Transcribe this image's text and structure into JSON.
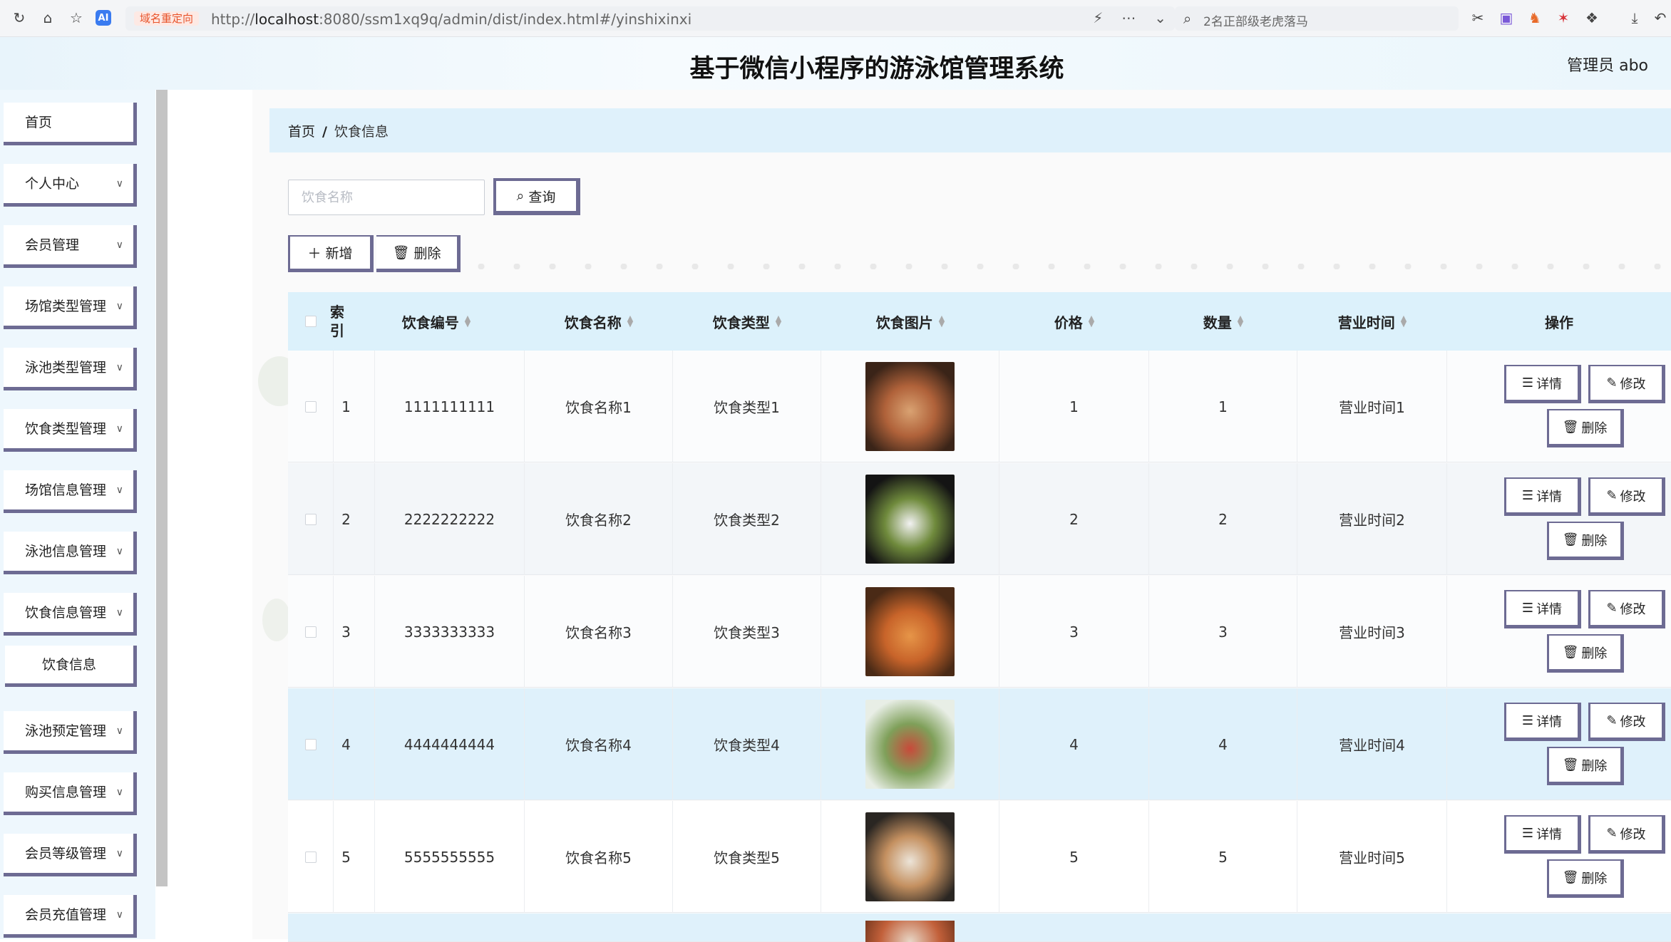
{
  "browser": {
    "redirect_badge": "域名重定向",
    "url_prefix": "http://",
    "url_host": "localhost",
    "url_rest": ":8080/ssm1xq9q/admin/dist/index.html#/yinshixinxi",
    "search_text": "2名正部级老虎落马"
  },
  "header": {
    "title": "基于微信小程序的游泳馆管理系统",
    "user": "管理员 abo"
  },
  "sidebar": {
    "items": [
      {
        "label": "首页",
        "has_arrow": false
      },
      {
        "label": "个人中心",
        "has_arrow": true
      },
      {
        "label": "会员管理",
        "has_arrow": true
      },
      {
        "label": "场馆类型管理",
        "has_arrow": true
      },
      {
        "label": "泳池类型管理",
        "has_arrow": true
      },
      {
        "label": "饮食类型管理",
        "has_arrow": true
      },
      {
        "label": "场馆信息管理",
        "has_arrow": true
      },
      {
        "label": "泳池信息管理",
        "has_arrow": true
      },
      {
        "label": "饮食信息管理",
        "has_arrow": true
      },
      {
        "label": "饮食信息",
        "has_arrow": false,
        "sub": true
      },
      {
        "label": "泳池预定管理",
        "has_arrow": true
      },
      {
        "label": "购买信息管理",
        "has_arrow": true
      },
      {
        "label": "会员等级管理",
        "has_arrow": true
      },
      {
        "label": "会员充值管理",
        "has_arrow": true
      }
    ]
  },
  "breadcrumb": {
    "home": "首页",
    "separator": "/",
    "current": "饮食信息"
  },
  "search": {
    "placeholder": "饮食名称",
    "value": "",
    "query_label": "查询"
  },
  "toolbar": {
    "add_label": "新增",
    "delete_label": "删除"
  },
  "table": {
    "headers": {
      "index": "索引",
      "code": "饮食编号",
      "name": "饮食名称",
      "type": "饮食类型",
      "image": "饮食图片",
      "price": "价格",
      "quantity": "数量",
      "hours": "营业时间",
      "actions": "操作"
    },
    "rows": [
      {
        "index": "1",
        "code": "1111111111",
        "name": "饮食名称1",
        "type": "饮食类型1",
        "price": "1",
        "quantity": "1",
        "hours": "营业时间1",
        "image_colors": [
          "#3a2418",
          "#b0623a",
          "#d9a272"
        ]
      },
      {
        "index": "2",
        "code": "2222222222",
        "name": "饮食名称2",
        "type": "饮食类型2",
        "price": "2",
        "quantity": "2",
        "hours": "营业时间2",
        "image_colors": [
          "#141414",
          "#6f8a3c",
          "#f2f2f2"
        ]
      },
      {
        "index": "3",
        "code": "3333333333",
        "name": "饮食名称3",
        "type": "饮食类型3",
        "price": "3",
        "quantity": "3",
        "hours": "营业时间3",
        "image_colors": [
          "#4a2a16",
          "#c8642a",
          "#e69548"
        ]
      },
      {
        "index": "4",
        "code": "4444444444",
        "name": "饮食名称4",
        "type": "饮食类型4",
        "price": "4",
        "quantity": "4",
        "hours": "营业时间4",
        "image_colors": [
          "#e8eee6",
          "#7fa05a",
          "#c84a3a"
        ]
      },
      {
        "index": "5",
        "code": "5555555555",
        "name": "饮食名称5",
        "type": "饮食类型5",
        "price": "5",
        "quantity": "5",
        "hours": "营业时间5",
        "image_colors": [
          "#2a2622",
          "#c49060",
          "#ece4d8"
        ]
      }
    ],
    "op_labels": {
      "detail": "详情",
      "edit": "修改",
      "delete": "删除"
    }
  },
  "colors": {
    "accent_border": "#6d6b93",
    "header_bg": "#dcf1fb",
    "sidebar_bg": "#eef7fd",
    "striped_row": "#f3f6f9",
    "highlight_row": "#dff1fb"
  }
}
